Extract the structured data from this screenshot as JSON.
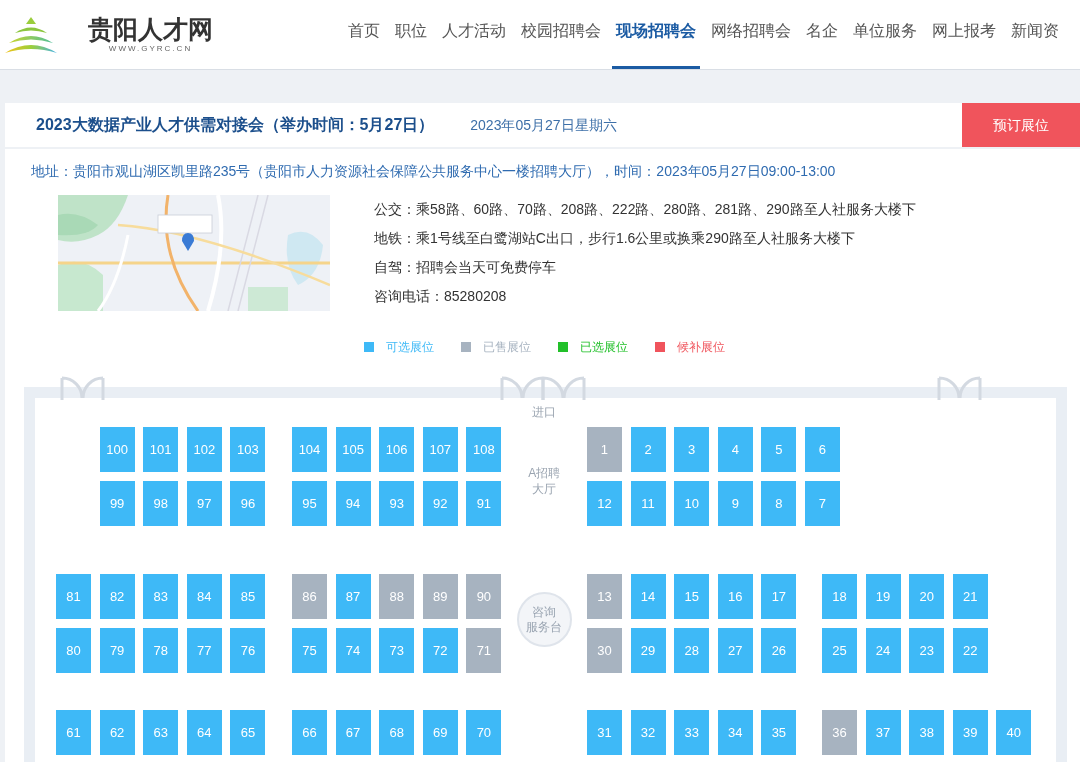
{
  "header": {
    "logo": {
      "name": "贵阳人才网",
      "url": "WWW.GYRC.CN"
    },
    "nav": [
      {
        "label": "首页",
        "selected": false
      },
      {
        "label": "职位",
        "selected": false
      },
      {
        "label": "人才活动",
        "selected": false
      },
      {
        "label": "校园招聘会",
        "selected": false
      },
      {
        "label": "现场招聘会",
        "selected": true
      },
      {
        "label": "网络招聘会",
        "selected": false
      },
      {
        "label": "名企",
        "selected": false
      },
      {
        "label": "单位服务",
        "selected": false
      },
      {
        "label": "网上报考",
        "selected": false
      },
      {
        "label": "新闻资",
        "selected": false
      }
    ]
  },
  "fair": {
    "title": "2023大数据产业人才供需对接会（举办时间：5月27日）",
    "date": "2023年05月27日星期六",
    "button": "预订展位",
    "address": "地址：贵阳市观山湖区凯里路235号（贵阳市人力资源社会保障公共服务中心一楼招聘大厅），时间：2023年05月27日09:00-13:00",
    "details": [
      "公交：乘58路、60路、70路、208路、222路、280路、281路、290路至人社服务大楼下",
      "地铁：乘1号线至白鹭湖站C出口，步行1.6公里或换乘290路至人社服务大楼下",
      "自驾：招聘会当天可免费停车",
      "咨询电话：85280208"
    ]
  },
  "legend": [
    {
      "label": "可选展位",
      "color": "#3eb9f7"
    },
    {
      "label": "已售展位",
      "color": "#a7b3c0"
    },
    {
      "label": "已选展位",
      "color": "#22c02a"
    },
    {
      "label": "候补展位",
      "color": "#f0545c"
    }
  ],
  "floor_plan": {
    "entrance": "进口",
    "blocks": [
      {
        "center": {
          "kind": "hall",
          "text": "A招聘大厅"
        },
        "rows": [
          {
            "groups": [
              [
                {
                  "number": "100",
                  "sold": false
                },
                {
                  "number": "101",
                  "sold": false
                },
                {
                  "number": "102",
                  "sold": false
                },
                {
                  "number": "103",
                  "sold": false
                }
              ],
              [
                {
                  "number": "104",
                  "sold": false
                },
                {
                  "number": "105",
                  "sold": false
                },
                {
                  "number": "106",
                  "sold": false
                },
                {
                  "number": "107",
                  "sold": false
                },
                {
                  "number": "108",
                  "sold": false
                }
              ],
              [
                {
                  "number": "1",
                  "sold": true
                },
                {
                  "number": "2",
                  "sold": false
                },
                {
                  "number": "3",
                  "sold": false
                },
                {
                  "number": "4",
                  "sold": false
                },
                {
                  "number": "5",
                  "sold": false
                },
                {
                  "number": "6",
                  "sold": false
                }
              ]
            ]
          },
          {
            "groups": [
              [
                {
                  "number": "99",
                  "sold": false
                },
                {
                  "number": "98",
                  "sold": false
                },
                {
                  "number": "97",
                  "sold": false
                },
                {
                  "number": "96",
                  "sold": false
                }
              ],
              [
                {
                  "number": "95",
                  "sold": false
                },
                {
                  "number": "94",
                  "sold": false
                },
                {
                  "number": "93",
                  "sold": false
                },
                {
                  "number": "92",
                  "sold": false
                },
                {
                  "number": "91",
                  "sold": false
                }
              ],
              [
                {
                  "number": "12",
                  "sold": false
                },
                {
                  "number": "11",
                  "sold": false
                },
                {
                  "number": "10",
                  "sold": false
                },
                {
                  "number": "9",
                  "sold": false
                },
                {
                  "number": "8",
                  "sold": false
                },
                {
                  "number": "7",
                  "sold": false
                }
              ]
            ]
          }
        ]
      },
      {
        "center": {
          "kind": "desk",
          "text": "咨询服务台"
        },
        "rows": [
          {
            "groups": [
              [
                {
                  "number": "81",
                  "sold": false
                },
                {
                  "number": "82",
                  "sold": false
                },
                {
                  "number": "83",
                  "sold": false
                },
                {
                  "number": "84",
                  "sold": false
                },
                {
                  "number": "85",
                  "sold": false
                }
              ],
              [
                {
                  "number": "86",
                  "sold": true
                },
                {
                  "number": "87",
                  "sold": false
                },
                {
                  "number": "88",
                  "sold": true
                },
                {
                  "number": "89",
                  "sold": true
                },
                {
                  "number": "90",
                  "sold": true
                }
              ],
              [
                {
                  "number": "13",
                  "sold": true
                },
                {
                  "number": "14",
                  "sold": false
                },
                {
                  "number": "15",
                  "sold": false
                },
                {
                  "number": "16",
                  "sold": false
                },
                {
                  "number": "17",
                  "sold": false
                }
              ],
              [
                {
                  "number": "18",
                  "sold": false
                },
                {
                  "number": "19",
                  "sold": false
                },
                {
                  "number": "20",
                  "sold": false
                },
                {
                  "number": "21",
                  "sold": false
                }
              ]
            ]
          },
          {
            "groups": [
              [
                {
                  "number": "80",
                  "sold": false
                },
                {
                  "number": "79",
                  "sold": false
                },
                {
                  "number": "78",
                  "sold": false
                },
                {
                  "number": "77",
                  "sold": false
                },
                {
                  "number": "76",
                  "sold": false
                }
              ],
              [
                {
                  "number": "75",
                  "sold": false
                },
                {
                  "number": "74",
                  "sold": false
                },
                {
                  "number": "73",
                  "sold": false
                },
                {
                  "number": "72",
                  "sold": false
                },
                {
                  "number": "71",
                  "sold": true
                }
              ],
              [
                {
                  "number": "30",
                  "sold": true
                },
                {
                  "number": "29",
                  "sold": false
                },
                {
                  "number": "28",
                  "sold": false
                },
                {
                  "number": "27",
                  "sold": false
                },
                {
                  "number": "26",
                  "sold": false
                }
              ],
              [
                {
                  "number": "25",
                  "sold": false
                },
                {
                  "number": "24",
                  "sold": false
                },
                {
                  "number": "23",
                  "sold": false
                },
                {
                  "number": "22",
                  "sold": false
                }
              ]
            ]
          }
        ]
      },
      {
        "rows": [
          {
            "groups": [
              [
                {
                  "number": "61",
                  "sold": false
                },
                {
                  "number": "62",
                  "sold": false
                },
                {
                  "number": "63",
                  "sold": false
                },
                {
                  "number": "64",
                  "sold": false
                },
                {
                  "number": "65",
                  "sold": false
                }
              ],
              [
                {
                  "number": "66",
                  "sold": false
                },
                {
                  "number": "67",
                  "sold": false
                },
                {
                  "number": "68",
                  "sold": false
                },
                {
                  "number": "69",
                  "sold": false
                },
                {
                  "number": "70",
                  "sold": false
                }
              ],
              [
                {
                  "number": "31",
                  "sold": false
                },
                {
                  "number": "32",
                  "sold": false
                },
                {
                  "number": "33",
                  "sold": false
                },
                {
                  "number": "34",
                  "sold": false
                },
                {
                  "number": "35",
                  "sold": false
                }
              ],
              [
                {
                  "number": "36",
                  "sold": true
                },
                {
                  "number": "37",
                  "sold": false
                },
                {
                  "number": "38",
                  "sold": false
                },
                {
                  "number": "39",
                  "sold": false
                },
                {
                  "number": "40",
                  "sold": false
                }
              ]
            ]
          }
        ]
      }
    ]
  }
}
